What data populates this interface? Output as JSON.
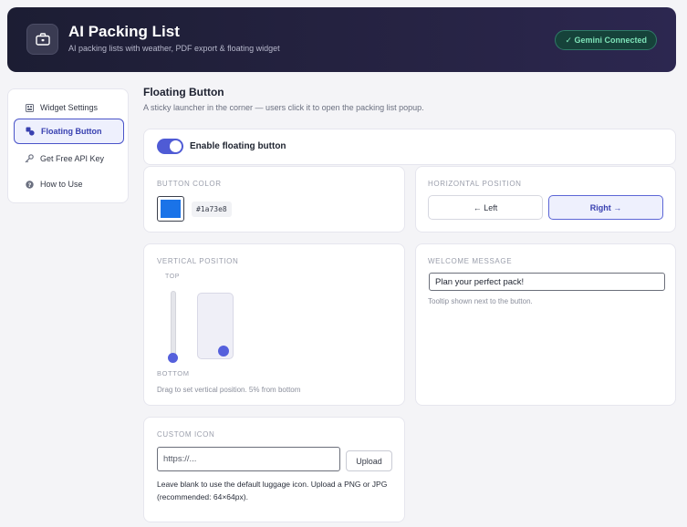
{
  "header": {
    "title": "AI Packing List",
    "subtitle": "AI packing lists with weather, PDF export & floating widget",
    "status": "✓ Gemini Connected",
    "icon": "briefcase-icon"
  },
  "sidebar": {
    "items": [
      {
        "label": "Widget Settings",
        "icon": "grid-icon",
        "active": false
      },
      {
        "label": "Floating Button",
        "icon": "shapes-icon",
        "active": true
      },
      {
        "label": "Get Free API Key",
        "icon": "key-icon",
        "active": false
      },
      {
        "label": "How to Use",
        "icon": "help-icon",
        "active": false
      }
    ]
  },
  "section": {
    "title": "Floating Button",
    "description": "A sticky launcher in the corner — users click it to open the packing list popup."
  },
  "enable": {
    "label": "Enable floating button",
    "checked": true
  },
  "button_color": {
    "label": "BUTTON COLOR",
    "value": "#1a73e8"
  },
  "horizontal": {
    "label": "HORIZONTAL POSITION",
    "left_label": "← Left",
    "right_label": "Right →",
    "selected": "right"
  },
  "vertical": {
    "label": "VERTICAL POSITION",
    "top_label": "TOP",
    "bottom_label": "BOTTOM",
    "hint": "Drag to set vertical position. 5% from bottom",
    "value_percent_from_bottom": 5
  },
  "welcome": {
    "label": "WELCOME MESSAGE",
    "value": "Plan your perfect pack!",
    "hint": "Tooltip shown next to the button."
  },
  "custom_icon": {
    "label": "CUSTOM ICON",
    "placeholder": "https://...",
    "upload_label": "Upload",
    "help": "Leave blank to use the default luggage icon. Upload a PNG or JPG (recommended: 64×64px)."
  },
  "colors": {
    "accent": "#4f5bd5",
    "header_bg": "#1c1d33",
    "success": "#7ee3b8",
    "swatch": "#1a73e8"
  }
}
